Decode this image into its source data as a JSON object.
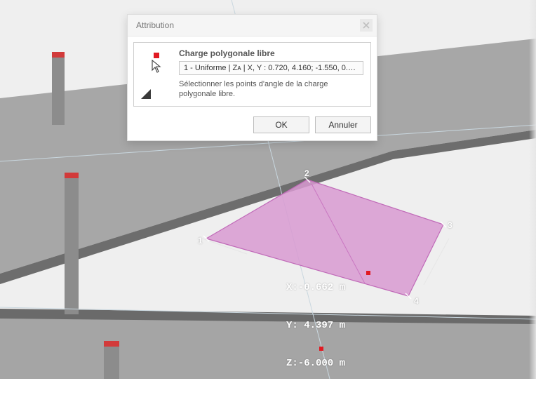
{
  "dialog": {
    "title": "Attribution",
    "heading": "Charge polygonale libre",
    "input_value": "1 - Uniforme | Zᴀ | X, Y : 0.720, 4.160; -1.550, 0.901;…",
    "hint": "Sélectionner les points d'angle de la charge polygonale libre.",
    "ok_label": "OK",
    "cancel_label": "Annuler",
    "close_icon": "close-icon"
  },
  "viewport": {
    "coord_x": "X:-0.662 m",
    "coord_y": "Y: 4.397 m",
    "coord_z": "Z:-6.000 m",
    "vertex_labels": [
      "1",
      "2",
      "3",
      "4"
    ]
  }
}
